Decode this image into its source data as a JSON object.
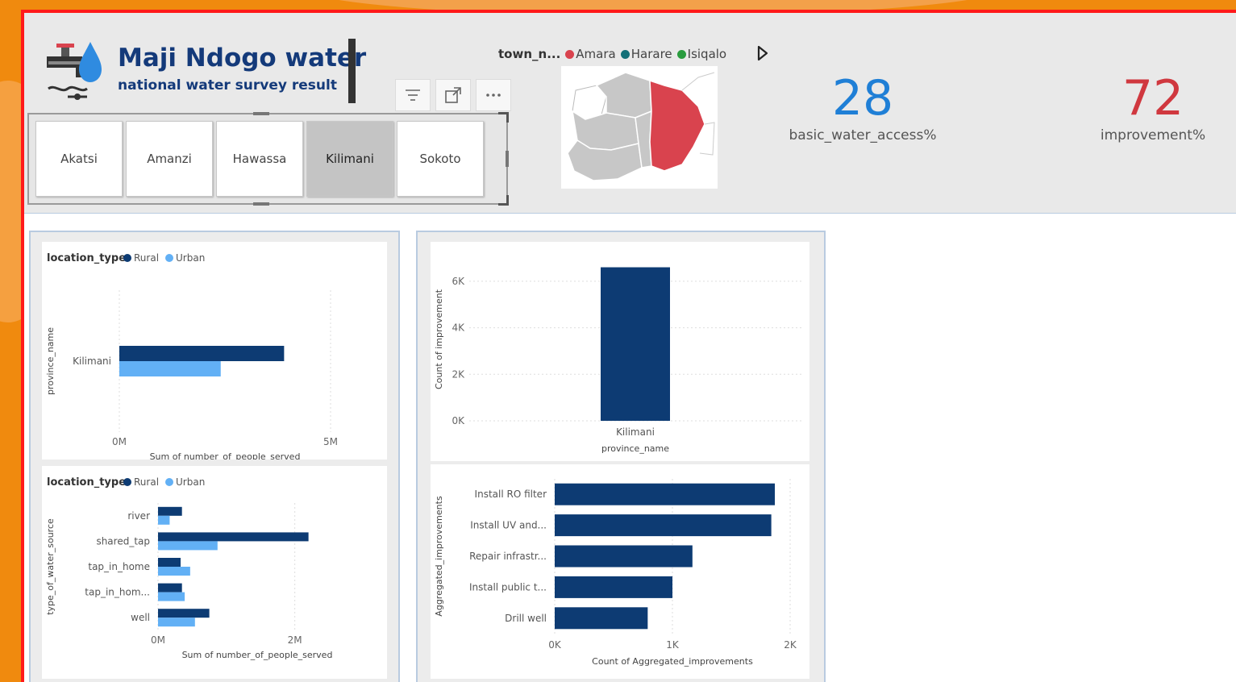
{
  "colors": {
    "rural": "#0d3b73",
    "urban": "#62b0f5",
    "amara": "#d9434e",
    "harare": "#137078",
    "isiqalo": "#2a9c3f",
    "kpi_blue": "#1f7fd6",
    "kpi_red": "#d0383f"
  },
  "header": {
    "title": "Maji Ndogo water",
    "subtitle": "national water survey result"
  },
  "toolbar_icons": [
    "filter-icon",
    "focus-mode-icon",
    "more-options-icon"
  ],
  "slicer": {
    "items": [
      {
        "label": "Akatsi",
        "selected": false
      },
      {
        "label": "Amanzi",
        "selected": false
      },
      {
        "label": "Hawassa",
        "selected": false
      },
      {
        "label": "Kilimani",
        "selected": true
      },
      {
        "label": "Sokoto",
        "selected": false
      }
    ]
  },
  "map": {
    "legend_title": "town_n...",
    "legend": [
      "Amara",
      "Harare",
      "Isiqalo"
    ],
    "highlighted_region": "Kilimani"
  },
  "kpis": [
    {
      "value": "28",
      "label": "basic_water_access%"
    },
    {
      "value": "72",
      "label": "improvement%"
    }
  ],
  "chart_data": [
    {
      "type": "bar",
      "orientation": "horizontal",
      "legend_title": "location_type",
      "categories": [
        "Kilimani"
      ],
      "series": [
        {
          "name": "Rural",
          "values": [
            3.9
          ]
        },
        {
          "name": "Urban",
          "values": [
            2.4
          ]
        }
      ],
      "xlabel": "Sum of number_of_people_served",
      "ylabel": "province_name",
      "xlim": [
        0,
        5
      ],
      "xticks": [
        "0M",
        "5M"
      ],
      "unit": "M"
    },
    {
      "type": "bar",
      "orientation": "horizontal",
      "legend_title": "location_type",
      "categories": [
        "river",
        "shared_tap",
        "tap_in_home",
        "tap_in_hom...",
        "well"
      ],
      "series": [
        {
          "name": "Rural",
          "values": [
            0.35,
            2.2,
            0.33,
            0.35,
            0.75
          ]
        },
        {
          "name": "Urban",
          "values": [
            0.17,
            0.87,
            0.47,
            0.39,
            0.54
          ]
        }
      ],
      "xlabel": "Sum of number_of_people_served",
      "ylabel": "type_of_water_source",
      "xlim": [
        0,
        2.9
      ],
      "xticks": [
        "0M",
        "2M"
      ],
      "unit": "M"
    },
    {
      "type": "bar",
      "categories": [
        "Kilimani"
      ],
      "values": [
        6600
      ],
      "xlabel": "province_name",
      "ylabel": "Count of improvement",
      "ylim": [
        0,
        7000
      ],
      "yticks": [
        "0K",
        "2K",
        "4K",
        "6K"
      ]
    },
    {
      "type": "bar",
      "orientation": "horizontal",
      "categories": [
        "Install RO filter",
        "Install UV and...",
        "Repair infrastr...",
        "Install public t...",
        "Drill well"
      ],
      "values": [
        1870,
        1840,
        1170,
        1000,
        790
      ],
      "xlabel": "Count of Aggregated_improvements",
      "ylabel": "Aggregated_improvements",
      "xlim": [
        0,
        2000
      ],
      "xticks": [
        "0K",
        "1K",
        "2K"
      ]
    }
  ]
}
